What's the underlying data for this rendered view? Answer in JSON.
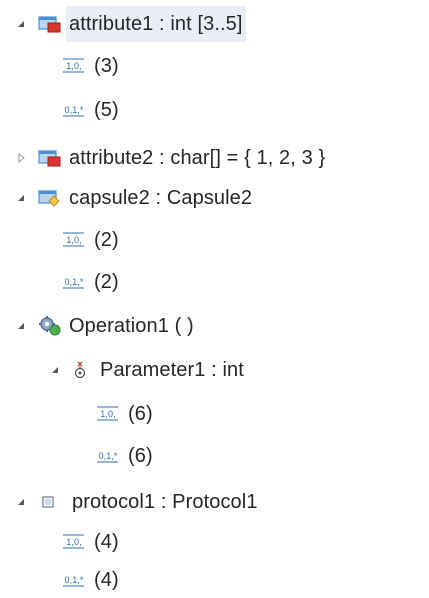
{
  "tree": {
    "attribute1": {
      "label": "attribute1 : int [3..5]",
      "lower": "(3)",
      "upper": "(5)"
    },
    "attribute2": {
      "label": "attribute2 : char[] = { 1, 2, 3 }"
    },
    "capsule2": {
      "label": "capsule2 : Capsule2",
      "lower": "(2)",
      "upper": "(2)"
    },
    "operation1": {
      "label": "Operation1 ( )",
      "parameter1": {
        "label": "Parameter1 : int",
        "lower": "(6)",
        "upper": "(6)"
      }
    },
    "protocol1": {
      "label": "protocol1 : Protocol1",
      "lower": "(4)",
      "upper": "(4)"
    }
  },
  "icons": {
    "lower_bound_glyph": "1,0,",
    "upper_bound_glyph": "0,1,*",
    "expanded": "expanded-triangle",
    "collapsed": "collapsed-triangle"
  },
  "colors": {
    "selection": "#e9eef6",
    "bound_icon": "#2f6db5",
    "attribute_icon_red": "#d9362f",
    "attribute_icon_blue": "#4a8fd4"
  }
}
